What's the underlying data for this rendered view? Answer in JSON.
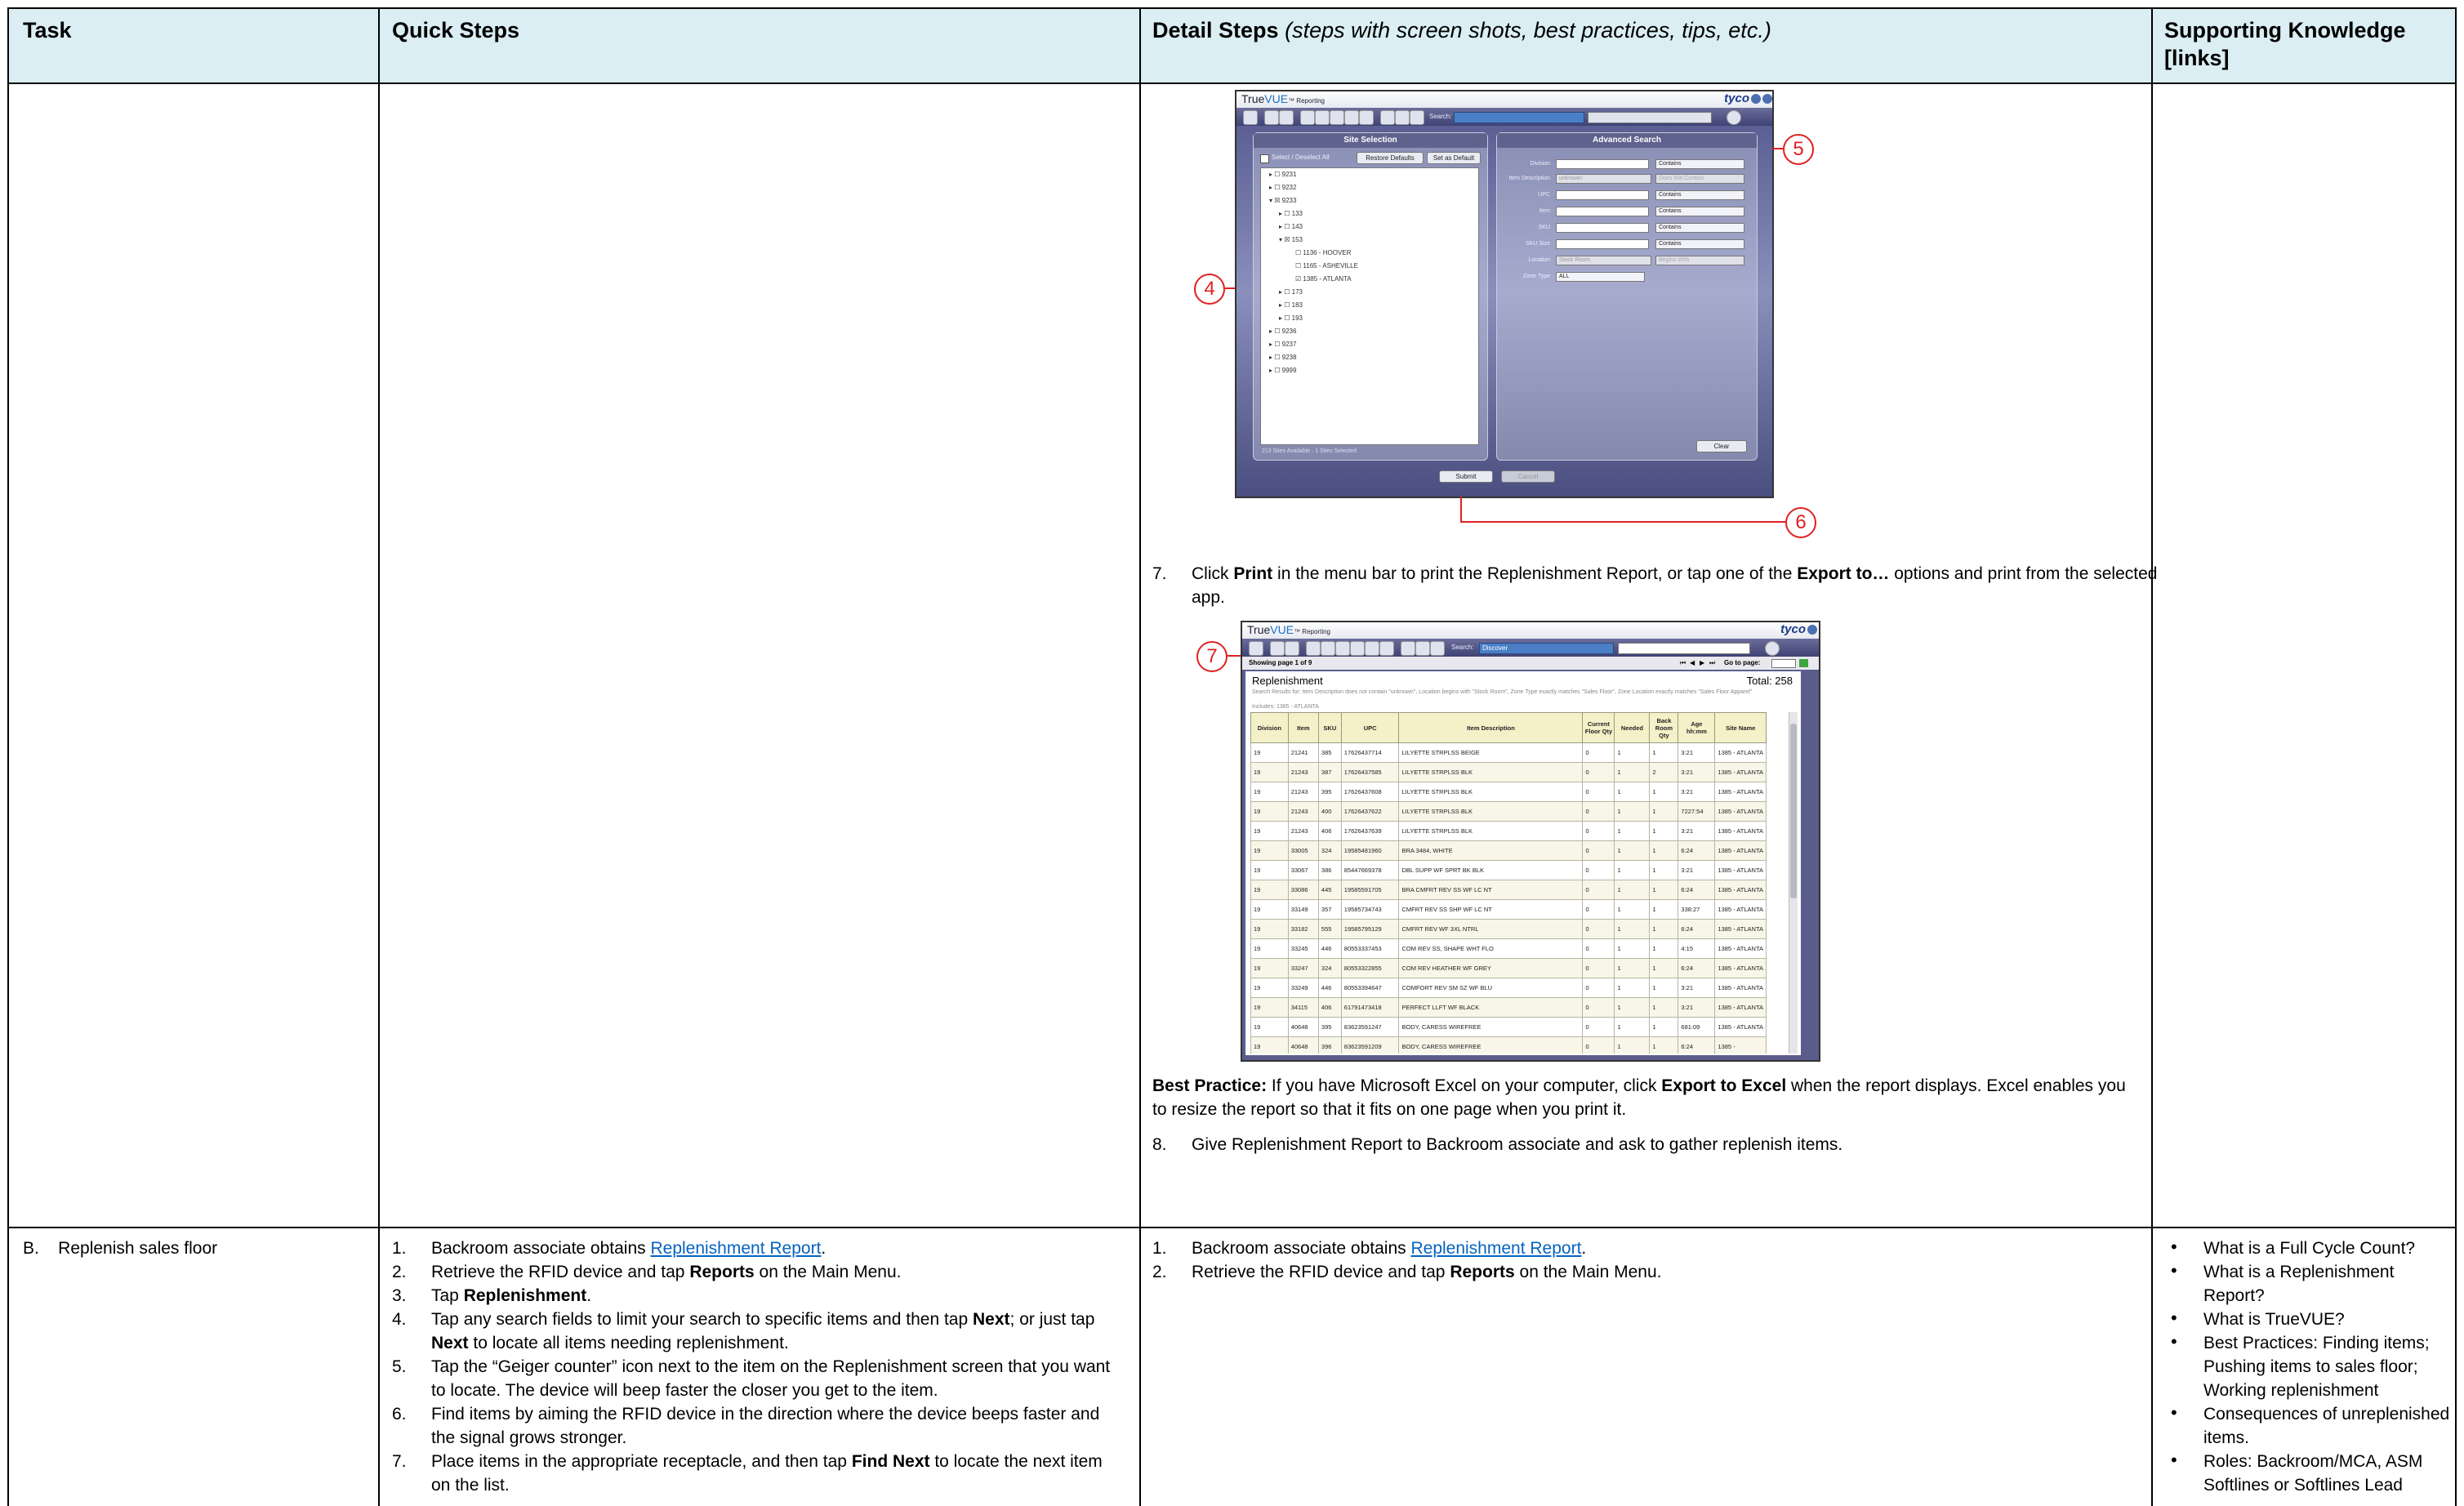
{
  "header": {
    "task": "Task",
    "quick": "Quick Steps",
    "detail_bold": "Detail Steps",
    "detail_italic": "(steps with screen shots, best practices, tips, etc.)",
    "support_line1": "Supporting Knowledge",
    "support_line2": "[links]"
  },
  "row1": {
    "shot1": {
      "app_name": "True",
      "app_name_accent": "VUE",
      "app_suffix": "™ Reporting",
      "brand": "tyco",
      "search_label": "Search:",
      "site_selection_title": "Site Selection",
      "advanced_search_title": "Advanced Search",
      "select_all": "Select / Deselect All",
      "restore_defaults": "Restore Defaults",
      "set_default": "Set as Default",
      "tree": [
        "9231",
        "9232",
        "9233",
        "133",
        "143",
        "153",
        "1136 - HOOVER",
        "1165 - ASHEVILLE",
        "1385 - ATLANTA",
        "173",
        "183",
        "193",
        "9236",
        "9237",
        "9238",
        "9999"
      ],
      "sites_status": "213 Sites Available · 1 Sites Selected",
      "fields": [
        "Division",
        "Item Description",
        "UPC",
        "Item",
        "SKU",
        "SKU Size",
        "Location",
        "Zone Type"
      ],
      "item_desc_value": "unknown",
      "location_value": "Stock Room",
      "zone_value": "ALL",
      "contains": "Contains",
      "does_not_contain": "Does Not Contain",
      "begins_with": "Begins With",
      "clear": "Clear",
      "submit": "Submit",
      "cancel": "Cancel"
    },
    "callouts": {
      "c4": "4",
      "c5": "5",
      "c6": "6",
      "c7": "7"
    },
    "step7": {
      "num": "7.",
      "t1": "Click ",
      "b1": "Print",
      "t2": " in the menu bar to print the Replenishment Report, or tap one of the ",
      "b2": "Export to…",
      "t3": " options and print from the selected app."
    },
    "shot2": {
      "app_name": "True",
      "app_name_accent": "VUE",
      "app_suffix": "™ Reporting",
      "brand": "tyco",
      "search_label": "Search:",
      "search_value": "Discover",
      "showing": "Showing page  1  of  9",
      "goto": "Go to page:",
      "report_title": "Replenishment",
      "total": "Total: 258",
      "criteria": "Search Results for: Item Description does not contain \"unknown\", Location begins with \"Stock Room\", Zone Type exactly matches \"Sales Floor\", Zone Location exactly matches \"Sales Floor Apparel\"",
      "includes": "Includes: 1385 - ATLANTA",
      "columns": [
        "Division",
        "Item",
        "SKU",
        "UPC",
        "Item Description",
        "Current Floor Qty",
        "Needed",
        "Back Room Qty",
        "Age hh:mm",
        "Site Name"
      ],
      "rows": [
        [
          "19",
          "21241",
          "385",
          "17626437714",
          "LILYETTE STRPLSS BEIGE",
          "0",
          "1",
          "1",
          "3:21",
          "1385 - ATLANTA"
        ],
        [
          "19",
          "21243",
          "387",
          "17626437585",
          "LILYETTE STRPLSS BLK",
          "0",
          "1",
          "2",
          "3:21",
          "1385 - ATLANTA"
        ],
        [
          "19",
          "21243",
          "395",
          "17626437608",
          "LILYETTE STRPLSS BLK",
          "0",
          "1",
          "1",
          "3:21",
          "1385 - ATLANTA"
        ],
        [
          "19",
          "21243",
          "400",
          "17626437622",
          "LILYETTE STRPLSS BLK",
          "0",
          "1",
          "1",
          "7227:54",
          "1385 - ATLANTA"
        ],
        [
          "19",
          "21243",
          "406",
          "17626437639",
          "LILYETTE STRPLSS BLK",
          "0",
          "1",
          "1",
          "3:21",
          "1385 - ATLANTA"
        ],
        [
          "19",
          "33005",
          "324",
          "19585481960",
          "BRA 3484, WHITE",
          "0",
          "1",
          "1",
          "6:24",
          "1385 - ATLANTA"
        ],
        [
          "19",
          "33067",
          "386",
          "85447669378",
          "DBL SUPP WF SPRT BK BLK",
          "0",
          "1",
          "1",
          "3:21",
          "1385 - ATLANTA"
        ],
        [
          "19",
          "33086",
          "445",
          "19585591705",
          "BRA CMFRT REV SS WF LC NT",
          "0",
          "1",
          "1",
          "6:24",
          "1385 - ATLANTA"
        ],
        [
          "19",
          "33149",
          "357",
          "19585734743",
          "CMFRT REV SS SHP WF LC NT",
          "0",
          "1",
          "1",
          "338:27",
          "1385 - ATLANTA"
        ],
        [
          "19",
          "33182",
          "555",
          "19585795129",
          "CMFRT REV WF 3XL NTRL",
          "0",
          "1",
          "1",
          "6:24",
          "1385 - ATLANTA"
        ],
        [
          "19",
          "33245",
          "446",
          "80553337453",
          "COM REV SS, SHAPE WHT FLO",
          "0",
          "1",
          "1",
          "4:15",
          "1385 - ATLANTA"
        ],
        [
          "19",
          "33247",
          "324",
          "80553322855",
          "COM REV HEATHER WF GREY",
          "0",
          "1",
          "1",
          "6:24",
          "1385 - ATLANTA"
        ],
        [
          "19",
          "33249",
          "446",
          "80553394647",
          "COMFORT REV SM SZ WF BLU",
          "0",
          "1",
          "1",
          "3:21",
          "1385 - ATLANTA"
        ],
        [
          "19",
          "34115",
          "406",
          "61791473418",
          "PERFECT LLFT WF BLACK",
          "0",
          "1",
          "1",
          "3:21",
          "1385 - ATLANTA"
        ],
        [
          "19",
          "40648",
          "395",
          "83623591247",
          "BODY, CARESS WIREFREE",
          "0",
          "1",
          "1",
          "681:09",
          "1385 - ATLANTA"
        ],
        [
          "19",
          "40648",
          "396",
          "83623591209",
          "BODY, CARESS WIREFREE",
          "0",
          "1",
          "1",
          "6:24",
          "1385 -"
        ]
      ]
    },
    "best_practice": {
      "label": "Best Practice:",
      "t1": " If you have Microsoft Excel on your computer, click ",
      "b1": "Export to Excel",
      "t2": " when the report displays. Excel enables you to resize the report so that it fits on one page when you print it."
    },
    "step8": {
      "num": "8.",
      "text": "Give Replenishment Report to Backroom associate and ask to gather replenish items."
    }
  },
  "row2": {
    "task": "B.    Replenish sales floor",
    "quick": [
      {
        "num": "1.",
        "parts": [
          {
            "t": "Backroom associate obtains "
          },
          {
            "link": "Replenishment Report"
          },
          {
            "t": "."
          }
        ]
      },
      {
        "num": "2.",
        "parts": [
          {
            "t": "Retrieve the RFID device and tap "
          },
          {
            "b": "Reports"
          },
          {
            "t": " on the Main Menu."
          }
        ]
      },
      {
        "num": "3.",
        "parts": [
          {
            "t": "Tap "
          },
          {
            "b": "Replenishment"
          },
          {
            "t": "."
          }
        ]
      },
      {
        "num": "4.",
        "parts": [
          {
            "t": "Tap any search fields to limit your search to specific items and then tap "
          },
          {
            "b": "Next"
          },
          {
            "t": "; or just tap "
          },
          {
            "b": "Next"
          },
          {
            "t": " to locate all items needing replenishment."
          }
        ]
      },
      {
        "num": "5.",
        "parts": [
          {
            "t": "Tap the “Geiger counter” icon next to the item on the Replenishment screen that you want to locate. The device will beep faster the closer you get to the item."
          }
        ]
      },
      {
        "num": "6.",
        "parts": [
          {
            "t": "Find items by aiming the RFID device in the direction where the device beeps faster and the signal grows stronger."
          }
        ]
      },
      {
        "num": "7.",
        "parts": [
          {
            "t": "Place items in the appropriate receptacle, and then tap "
          },
          {
            "b": "Find Next"
          },
          {
            "t": " to locate the next item on the list."
          }
        ]
      }
    ],
    "detail": [
      {
        "num": "1.",
        "parts": [
          {
            "t": "Backroom associate obtains "
          },
          {
            "link": "Replenishment Report"
          },
          {
            "t": "."
          }
        ]
      },
      {
        "num": "2.",
        "parts": [
          {
            "t": "Retrieve the RFID device and tap "
          },
          {
            "b": "Reports"
          },
          {
            "t": " on the Main Menu."
          }
        ]
      }
    ],
    "support": [
      "What is a Full Cycle Count?",
      "What is a Replenishment Report?",
      "What is TrueVUE?",
      "Best Practices: Finding items; Pushing items to sales floor; Working replenishment",
      "Consequences of unreplenished items.",
      "Roles: Backroom/MCA, ASM Softlines or Softlines Lead"
    ],
    "bullet": "•"
  }
}
